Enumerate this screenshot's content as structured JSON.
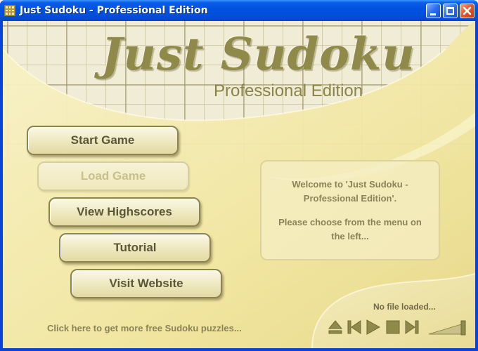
{
  "window": {
    "title": "Just Sudoku - Professional Edition",
    "controls": [
      "minimize",
      "maximize",
      "close"
    ]
  },
  "header": {
    "logo_title": "Just Sudoku",
    "logo_subtitle": "Professional Edition"
  },
  "menu": {
    "items": [
      {
        "label": "Start Game",
        "enabled": true
      },
      {
        "label": "Load Game",
        "enabled": false
      },
      {
        "label": "View Highscores",
        "enabled": true
      },
      {
        "label": "Tutorial",
        "enabled": true
      },
      {
        "label": "Visit Website",
        "enabled": true
      }
    ]
  },
  "welcome": {
    "line1": "Welcome to 'Just Sudoku - Professional Edition'.",
    "line2": "Please choose from the menu on the left..."
  },
  "footer": {
    "promo_link": "Click here to get more free Sudoku puzzles..."
  },
  "player": {
    "status": "No file loaded...",
    "buttons": [
      "eject-icon",
      "previous-icon",
      "play-icon",
      "stop-icon",
      "next-icon"
    ],
    "volume_icon": "volume-slider-icon"
  },
  "colors": {
    "titlebar": "#0052df",
    "background": "#f2e8a8",
    "button_text": "#5a5638",
    "muted_text": "#8a8358",
    "control_icons": "#8f8a4a"
  }
}
